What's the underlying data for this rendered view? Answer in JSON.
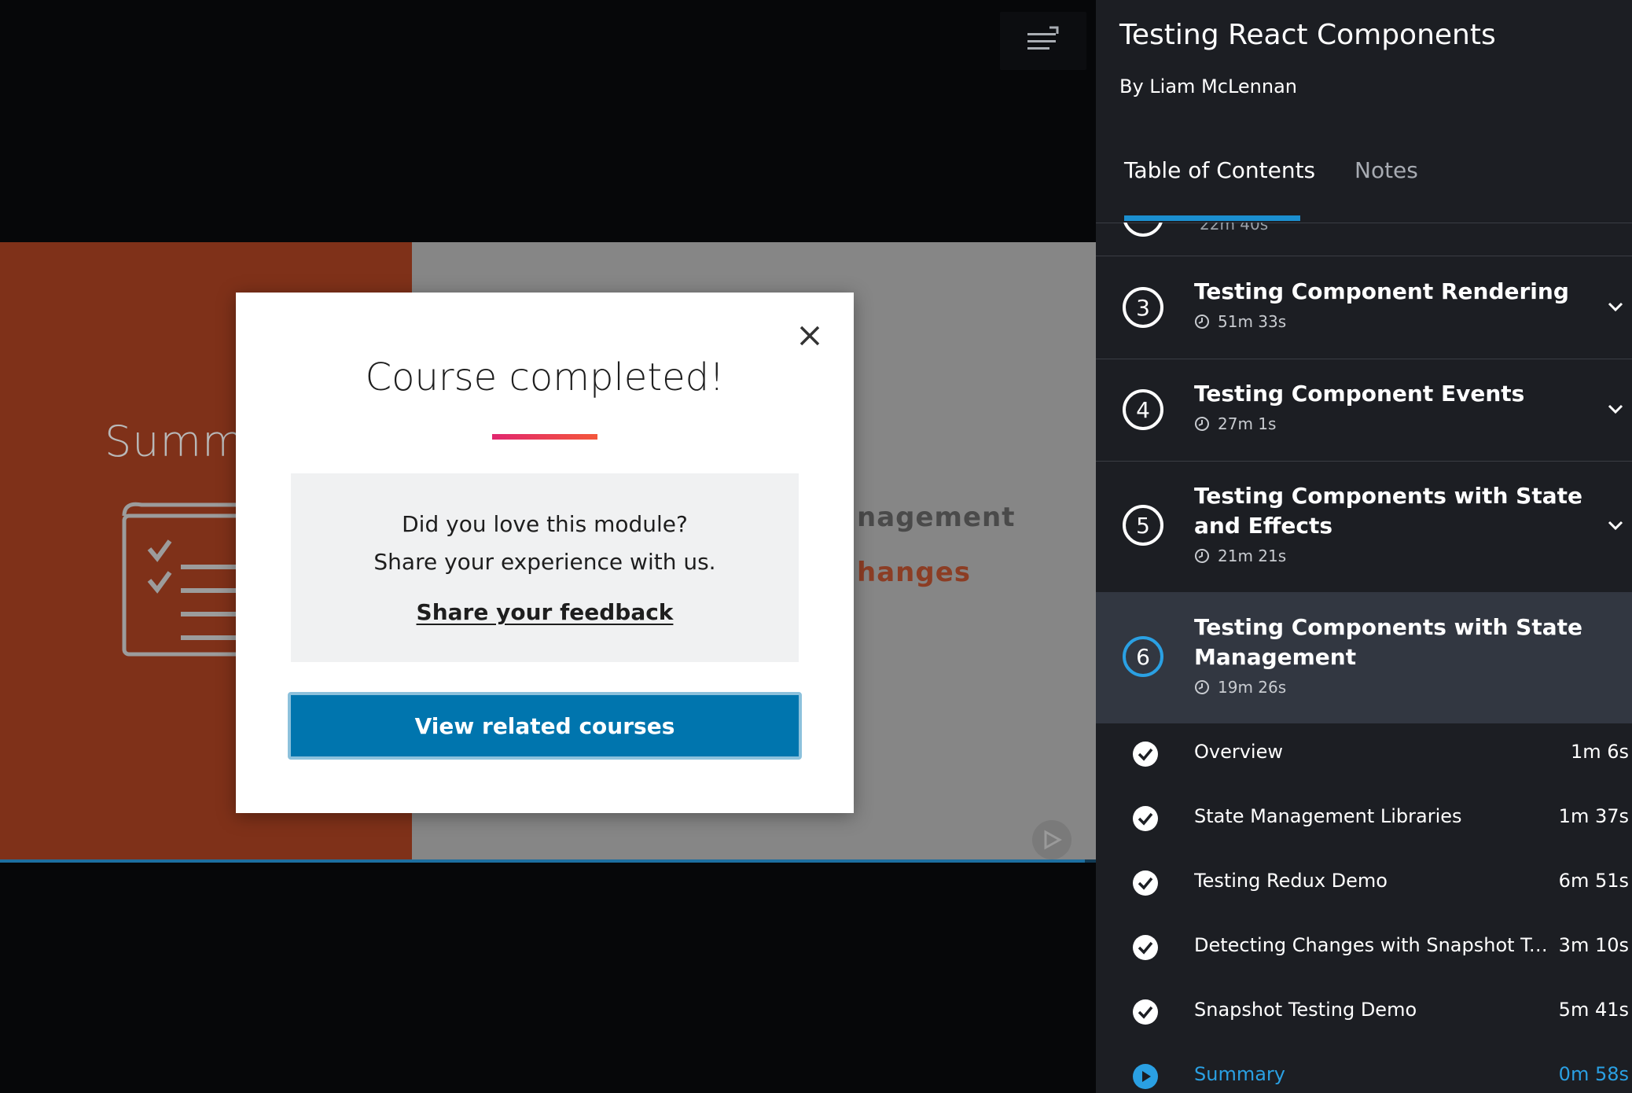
{
  "player": {
    "slide": {
      "title_partial": "Summ",
      "line1_partial": "nagement",
      "line2_partial": "hanges"
    },
    "progress_fraction": 0.99
  },
  "modal": {
    "title": "Course completed!",
    "feedback_question": "Did you love this module?",
    "feedback_sub": "Share your experience with us.",
    "feedback_link": "Share your feedback",
    "related_button": "View related courses"
  },
  "sidebar": {
    "course_title": "Testing React Components",
    "author": "By Liam McLennan",
    "tabs": {
      "toc": "Table of Contents",
      "notes": "Notes"
    },
    "partial_duration": "22m 40s",
    "modules": [
      {
        "number": "3",
        "title": "Testing Component Rendering",
        "duration": "51m 33s"
      },
      {
        "number": "4",
        "title": "Testing Component Events",
        "duration": "27m 1s"
      },
      {
        "number": "5",
        "title": "Testing Components with State and Effects",
        "duration": "21m 21s"
      },
      {
        "number": "6",
        "title": "Testing Components with State Management",
        "duration": "19m 26s"
      }
    ],
    "clips": [
      {
        "title": "Overview",
        "duration": "1m 6s"
      },
      {
        "title": "State Management Libraries",
        "duration": "1m 37s"
      },
      {
        "title": "Testing Redux Demo",
        "duration": "6m 51s"
      },
      {
        "title": "Detecting Changes with Snapshot Tes...",
        "duration": "3m 10s"
      },
      {
        "title": "Snapshot Testing Demo",
        "duration": "5m 41s"
      },
      {
        "title": "Summary",
        "duration": "0m 58s"
      }
    ]
  },
  "colors": {
    "accent_blue": "#0075ae",
    "active_blue": "#2aa0e3",
    "slide_rust": "#7f3119",
    "gradient_pink": "#e1276f",
    "gradient_orange": "#f4573b"
  },
  "icons": [
    "menu-icon",
    "close-icon",
    "clock-icon",
    "chevron-down-icon",
    "check-circle-icon",
    "play-circle-icon",
    "checklist-icon"
  ]
}
